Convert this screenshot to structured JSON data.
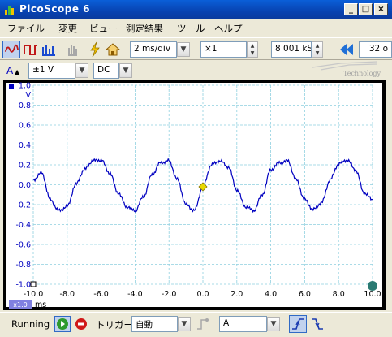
{
  "window": {
    "title": "PicoScope  6",
    "minimize_label": "_",
    "maximize_label": "□",
    "close_label": "×"
  },
  "menu": {
    "items": [
      "ファイル",
      "変更",
      "ビュー",
      "測定結果",
      "ツール",
      "ヘルプ"
    ]
  },
  "toolbar": {
    "timebase": "2 ms/div",
    "zoom": "×1",
    "samples": "8 001 kS",
    "capture_count": "32 o"
  },
  "channel_bar": {
    "channel": "A",
    "range": "±1 V",
    "coupling": "DC",
    "logo_text": "Technology"
  },
  "chart_data": {
    "type": "line",
    "title": "",
    "xlabel": "ms",
    "ylabel": "V",
    "xlim": [
      -10.0,
      10.0
    ],
    "ylim": [
      -1.0,
      1.0
    ],
    "x_ticks": [
      "-10.0",
      "-8.0",
      "-6.0",
      "-4.0",
      "-2.0",
      "0.0",
      "2.0",
      "4.0",
      "6.0",
      "8.0",
      "10.0"
    ],
    "y_ticks": [
      "1.0",
      "0.8",
      "0.6",
      "0.4",
      "0.2",
      "0.0",
      "-0.2",
      "-0.4",
      "-0.6",
      "-0.8",
      "-1.0"
    ],
    "x_ticks_per_division": 2.0,
    "scale_badge": "x1.0",
    "grid": true,
    "series": [
      {
        "color": "#0000c0",
        "x": [
          -10.0,
          -9.5,
          -9.0,
          -8.5,
          -8.0,
          -7.5,
          -7.0,
          -6.5,
          -6.0,
          -5.5,
          -5.0,
          -4.5,
          -4.0,
          -3.5,
          -3.0,
          -2.5,
          -2.0,
          -1.5,
          -1.0,
          -0.5,
          0.0,
          0.5,
          1.0,
          1.5,
          2.0,
          2.5,
          3.0,
          3.5,
          4.0,
          4.5,
          5.0,
          5.5,
          6.0,
          6.5,
          7.0,
          7.5,
          8.0,
          8.5,
          9.0,
          9.5,
          10.0
        ],
        "y": [
          0.05,
          0.12,
          -0.15,
          -0.26,
          -0.22,
          0.0,
          0.15,
          0.24,
          0.25,
          0.12,
          -0.08,
          -0.22,
          -0.26,
          -0.12,
          0.1,
          0.22,
          0.24,
          0.05,
          -0.2,
          -0.26,
          -0.02,
          0.2,
          0.24,
          0.18,
          -0.05,
          -0.22,
          -0.26,
          -0.1,
          0.15,
          0.22,
          0.24,
          0.05,
          -0.15,
          -0.25,
          -0.18,
          0.05,
          0.21,
          0.25,
          0.15,
          -0.08,
          -0.15
        ]
      }
    ],
    "trigger_marker": {
      "x": 0.0,
      "y": -0.02,
      "color": "#e8d800"
    },
    "ruler_marker_color": "#2a7a72"
  },
  "status": {
    "state": "Running",
    "trigger_label": "トリガー",
    "trigger_mode": "自動",
    "trigger_channel": "A"
  },
  "colors": {
    "accent_blue": "#0a5fd8",
    "trace": "#0000c0",
    "grid": "#8fd0e0",
    "go_green": "#2e9a2e",
    "stop_red": "#d01818"
  }
}
